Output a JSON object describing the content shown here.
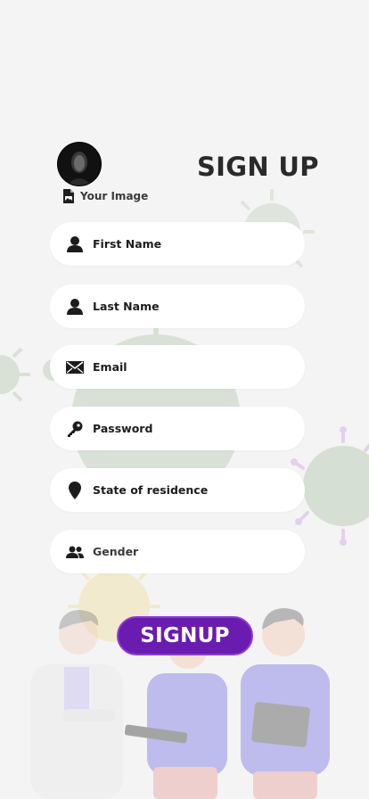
{
  "header": {
    "title": "SIGN UP",
    "avatar_label": "Your Image"
  },
  "form": {
    "fields": [
      {
        "label": "First Name",
        "icon": "user-icon"
      },
      {
        "label": "Last Name",
        "icon": "user-icon"
      },
      {
        "label": "Email",
        "icon": "envelope-icon"
      },
      {
        "label": "Password",
        "icon": "key-icon"
      },
      {
        "label": "State of residence",
        "icon": "map-pin-icon"
      },
      {
        "label": "Gender",
        "icon": "users-icon"
      }
    ]
  },
  "actions": {
    "signup_label": "SIGNUP"
  },
  "colors": {
    "accent": "#6a1bb0",
    "background": "#f4f4f4",
    "field": "#ffffff"
  }
}
